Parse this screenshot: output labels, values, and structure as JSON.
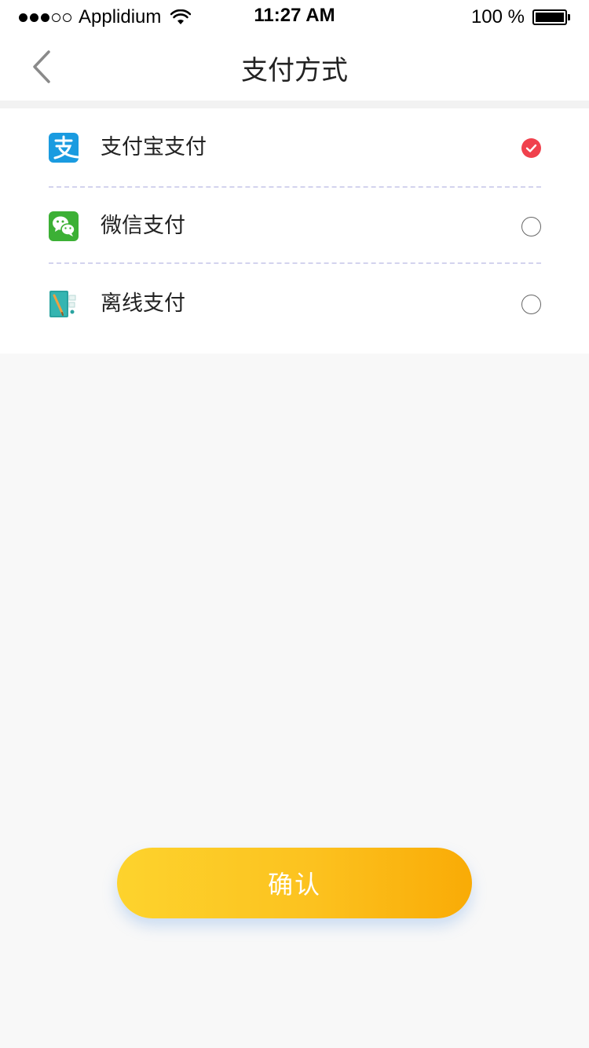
{
  "status_bar": {
    "carrier": "Applidium",
    "time": "11:27 AM",
    "battery": "100 %",
    "signal_bars_filled": 3,
    "signal_bars_total": 5
  },
  "nav": {
    "title": "支付方式",
    "back_icon": "chevron-left-icon"
  },
  "payment_methods": [
    {
      "label": "支付宝支付",
      "icon": "alipay-icon",
      "selected": true
    },
    {
      "label": "微信支付",
      "icon": "wechat-icon",
      "selected": false
    },
    {
      "label": "离线支付",
      "icon": "offline-notebook-icon",
      "selected": false
    }
  ],
  "confirm_button": {
    "label": "确认"
  },
  "colors": {
    "accent_selected": "#f0414d",
    "button_gradient_start": "#fdd32d",
    "button_gradient_end": "#f9ab06",
    "alipay_blue": "#1a9be0",
    "wechat_green": "#3cb035"
  }
}
